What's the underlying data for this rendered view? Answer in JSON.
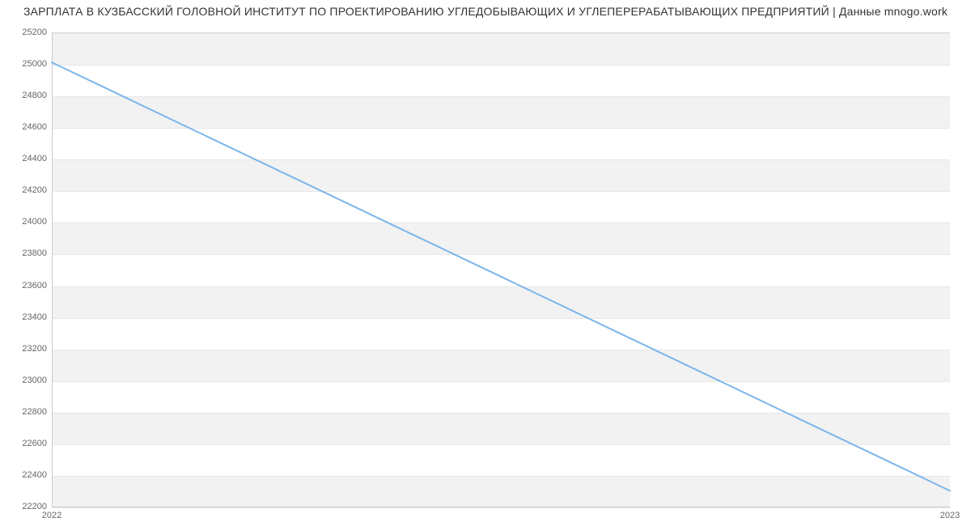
{
  "chart_data": {
    "type": "line",
    "title": "ЗАРПЛАТА В  КУЗБАССКИЙ ГОЛОВНОЙ ИНСТИТУТ ПО ПРОЕКТИРОВАНИЮ УГЛЕДОБЫВАЮЩИХ И УГЛЕПЕРЕРАБАТЫВАЮЩИХ ПРЕДПРИЯТИЙ | Данные mnogo.work",
    "xlabel": "",
    "ylabel": "",
    "x": [
      "2022",
      "2023"
    ],
    "series": [
      {
        "name": "salary",
        "values": [
          25010,
          22300
        ]
      }
    ],
    "ylim": [
      22200,
      25200
    ],
    "yticks": [
      22200,
      22400,
      22600,
      22800,
      23000,
      23200,
      23400,
      23600,
      23800,
      24000,
      24200,
      24400,
      24600,
      24800,
      25000,
      25200
    ],
    "grid": true,
    "line_color": "#7cb5ec"
  },
  "title": "ЗАРПЛАТА В  КУЗБАССКИЙ ГОЛОВНОЙ ИНСТИТУТ ПО ПРОЕКТИРОВАНИЮ УГЛЕДОБЫВАЮЩИХ И УГЛЕПЕРЕРАБАТЫВАЮЩИХ ПРЕДПРИЯТИЙ | Данные mnogo.work",
  "axes": {
    "y_ticks": [
      "22200",
      "22400",
      "22600",
      "22800",
      "23000",
      "23200",
      "23400",
      "23600",
      "23800",
      "24000",
      "24200",
      "24400",
      "24600",
      "24800",
      "25000",
      "25200"
    ],
    "x_ticks": [
      "2022",
      "2023"
    ]
  }
}
